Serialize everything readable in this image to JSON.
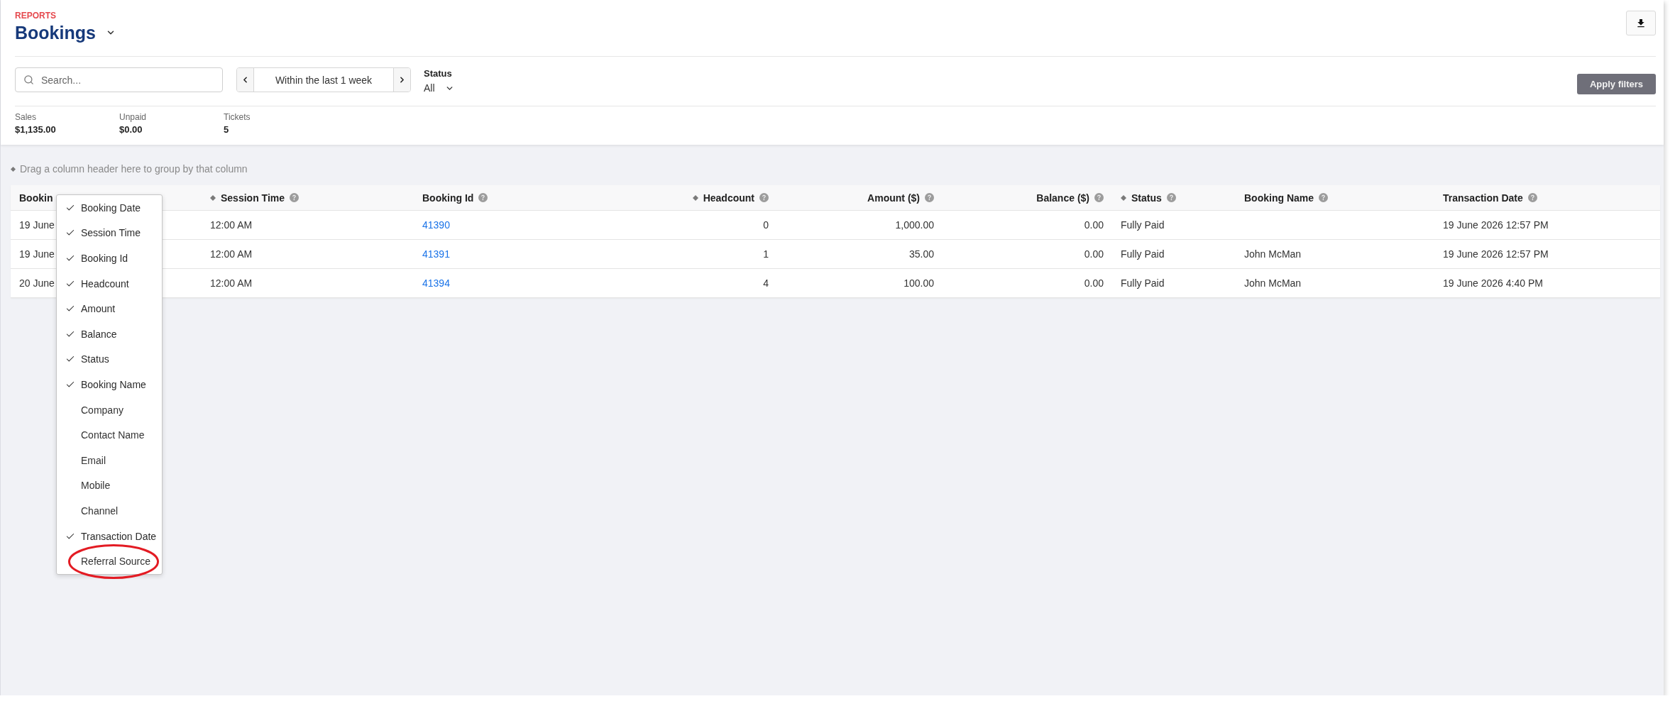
{
  "header": {
    "section": "REPORTS",
    "title": "Bookings"
  },
  "filters": {
    "search": {
      "placeholder": "Search..."
    },
    "date_range": "Within the last 1 week",
    "status": {
      "label": "Status",
      "value": "All"
    },
    "apply_button": "Apply filters"
  },
  "summary": [
    {
      "label": "Sales",
      "value": "$1,135.00"
    },
    {
      "label": "Unpaid",
      "value": "$0.00"
    },
    {
      "label": "Tickets",
      "value": "5"
    }
  ],
  "group_hint": "Drag a column header here to group by that column",
  "table": {
    "columns": [
      {
        "label": "Bookin",
        "kind": "text",
        "marked": false,
        "help": false
      },
      {
        "label": "Session Time",
        "kind": "text",
        "marked": true,
        "help": true
      },
      {
        "label": "Booking Id",
        "kind": "link",
        "marked": false,
        "help": true
      },
      {
        "label": "Headcount",
        "kind": "number",
        "marked": true,
        "help": true
      },
      {
        "label": "Amount ($)",
        "kind": "number",
        "marked": false,
        "help": true
      },
      {
        "label": "Balance ($)",
        "kind": "number",
        "marked": false,
        "help": true
      },
      {
        "label": "Status",
        "kind": "text",
        "marked": true,
        "help": true
      },
      {
        "label": "Booking Name",
        "kind": "text",
        "marked": false,
        "help": true
      },
      {
        "label": "Transaction Date",
        "kind": "text",
        "marked": false,
        "help": true
      }
    ],
    "rows": [
      [
        "19 June",
        "12:00 AM",
        "41390",
        "0",
        "1,000.00",
        "0.00",
        "Fully Paid",
        null,
        "19 June 2026 12:57 PM"
      ],
      [
        "19 June",
        "12:00 AM",
        "41391",
        "1",
        "35.00",
        "0.00",
        "Fully Paid",
        "John McMan",
        "19 June 2026 12:57 PM"
      ],
      [
        "20 June",
        "12:00 AM",
        "41394",
        "4",
        "100.00",
        "0.00",
        "Fully Paid",
        "John McMan",
        "19 June 2026 4:40 PM"
      ]
    ]
  },
  "column_menu": {
    "items": [
      {
        "label": "Booking Date",
        "checked": true,
        "circled": false
      },
      {
        "label": "Session Time",
        "checked": true,
        "circled": false
      },
      {
        "label": "Booking Id",
        "checked": true,
        "circled": false
      },
      {
        "label": "Headcount",
        "checked": true,
        "circled": false
      },
      {
        "label": "Amount",
        "checked": true,
        "circled": false
      },
      {
        "label": "Balance",
        "checked": true,
        "circled": false
      },
      {
        "label": "Status",
        "checked": true,
        "circled": false
      },
      {
        "label": "Booking Name",
        "checked": true,
        "circled": false
      },
      {
        "label": "Company",
        "checked": false,
        "circled": false
      },
      {
        "label": "Contact Name",
        "checked": false,
        "circled": false
      },
      {
        "label": "Email",
        "checked": false,
        "circled": false
      },
      {
        "label": "Mobile",
        "checked": false,
        "circled": false
      },
      {
        "label": "Channel",
        "checked": false,
        "circled": false
      },
      {
        "label": "Transaction Date",
        "checked": true,
        "circled": false
      },
      {
        "label": "Referral Source",
        "checked": false,
        "circled": true
      }
    ]
  }
}
